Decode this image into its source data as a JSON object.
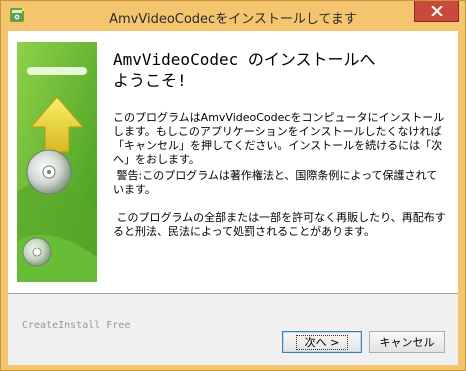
{
  "window": {
    "title": "AmvVideoCodecをインストールしてます",
    "close_symbol": "✕"
  },
  "wizard": {
    "heading_line1": "AmvVideoCodec のインストールへ",
    "heading_line2": "ようこそ!",
    "paragraph1": "このプログラムはAmvVideoCodecをコンピュータにインストールします。もしこのアプリケーションをインストールしたくなければ「キャンセル」を押してください。インストールを続けるには「次へ」をおします。",
    "paragraph2": " 警告:このプログラムは著作権法と、国際条例によって保護されています。",
    "paragraph3": " このプログラムの全部または一部を許可なく再販したり、再配布すると刑法、民法によって処罰されることがあります。"
  },
  "footer": {
    "installer_label": "CreateInstall Free",
    "next_label": "次へ >",
    "cancel_label": "キャンセル"
  },
  "icons": {
    "app_icon": "installer-app-icon",
    "side_graphic": "install-disc-arrow-graphic"
  },
  "colors": {
    "frame": "#f4c56e",
    "close_button": "#c74a3d",
    "side_green": "#6fbf2e",
    "arrow_yellow": "#f2e14a"
  }
}
